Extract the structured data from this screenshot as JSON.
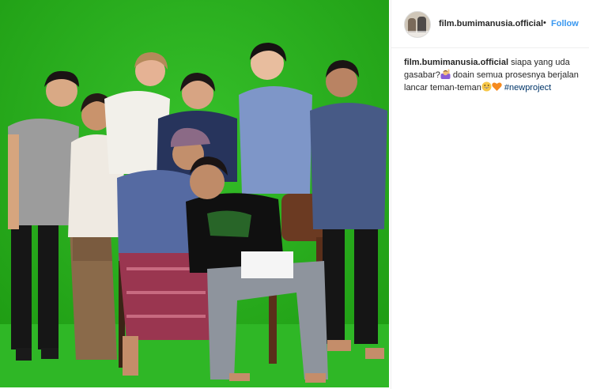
{
  "post": {
    "username": "film.bumimanusia.official",
    "separator": "•",
    "follow_label": "Follow",
    "caption_user": "film.bumimanusia.official",
    "caption_part1": " siapa yang uda gasabar?",
    "caption_part2": " doain semua prosesnya berjalan lancar teman-teman",
    "hashtag": "#newproject",
    "emojis": [
      "person-raising-hand-emoji",
      "grinning-face-emoji",
      "orange-heart-emoji"
    ]
  },
  "photo": {
    "subject": "group-photo-green-screen",
    "colors": {
      "green_screen": "#27b11b",
      "floor": "#31b82a"
    }
  },
  "colors": {
    "link": "#3897f0",
    "hashtag": "#003569",
    "text": "#262626",
    "border": "#efefef"
  }
}
